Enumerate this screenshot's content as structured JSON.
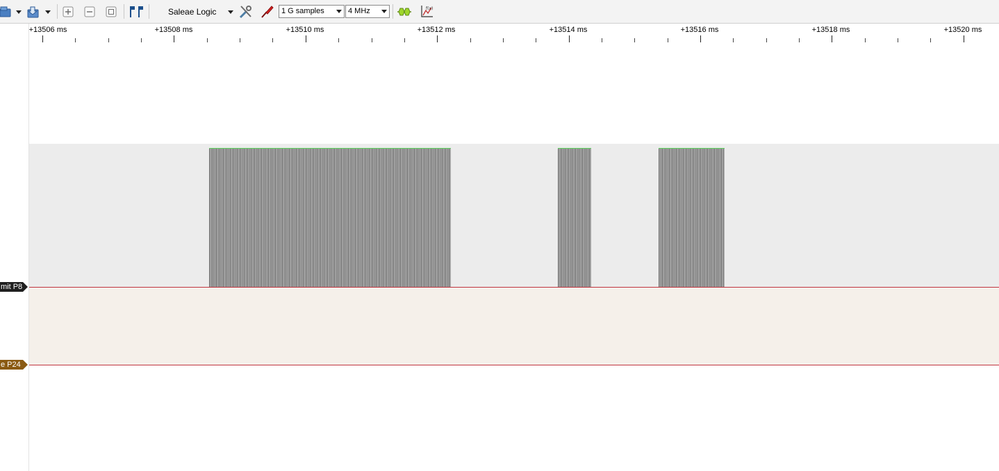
{
  "toolbar": {
    "device": "Saleae Logic",
    "samples": "1 G samples",
    "rate": "4 MHz",
    "icons": [
      "open-icon",
      "save-icon",
      "zoom-in-icon",
      "zoom-out-icon",
      "zoom-fit-icon",
      "markers-icon",
      "settings-icon",
      "probe-icon",
      "protocol-icon",
      "analyzer-icon"
    ]
  },
  "ruler": {
    "labels": [
      "+13506 ms",
      "+13508 ms",
      "+13510 ms",
      "+13512 ms",
      "+13514 ms",
      "+13516 ms",
      "+13518 ms",
      "+13520 ms"
    ]
  },
  "channels": [
    {
      "label": "mit P8",
      "color": "#1f1f1f",
      "bursts_ms": [
        [
          13508.5,
          13512.2
        ],
        [
          13513.85,
          13514.35
        ],
        [
          13515.4,
          13516.4
        ]
      ]
    },
    {
      "label": "e P24",
      "color": "#8a5a12"
    }
  ],
  "colors": {
    "lane0": "#ececec",
    "lane1": "#f5f0ea",
    "baseline": "#c0343f",
    "high": "#5ad05a"
  }
}
